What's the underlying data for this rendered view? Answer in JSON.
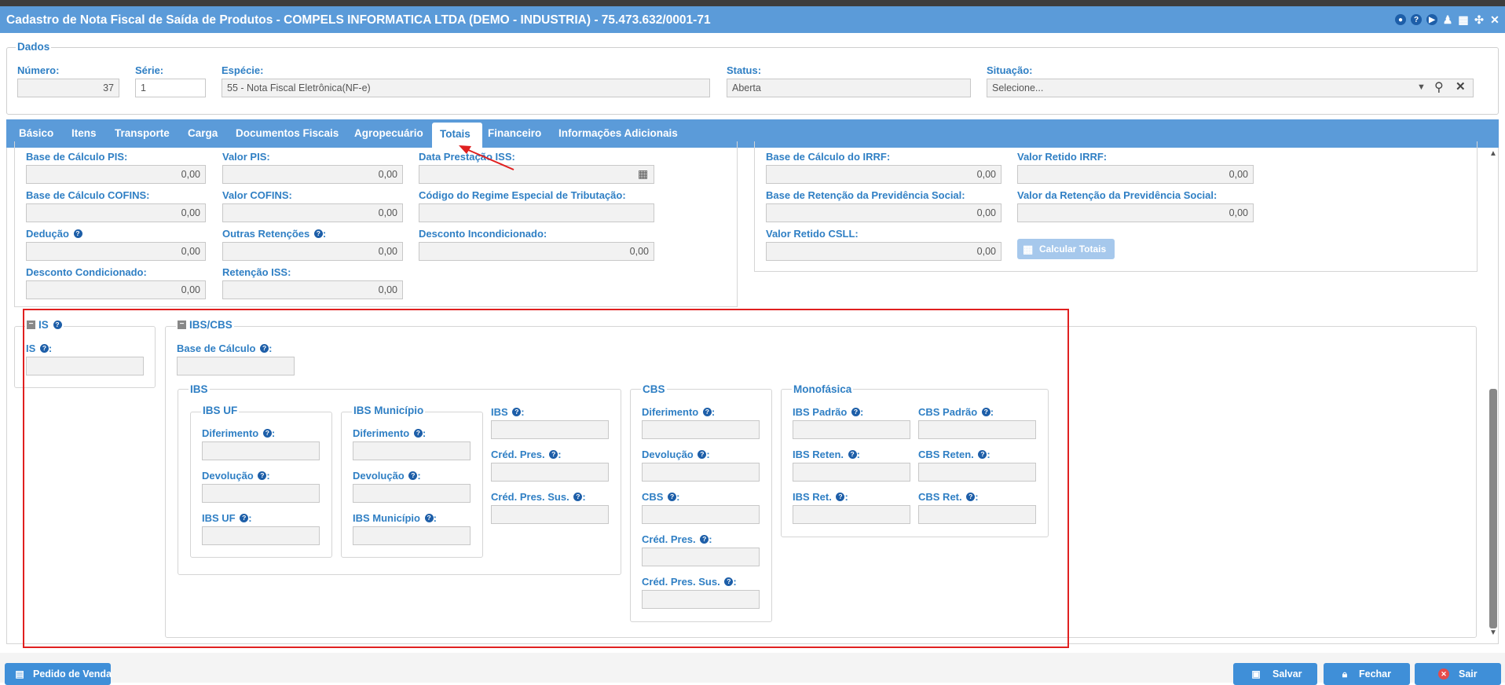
{
  "window": {
    "title": "Cadastro de Nota Fiscal de Saída de Produtos - COMPELS INFORMATICA LTDA (DEMO - INDUSTRIA) - 75.473.632/0001-71",
    "icons": [
      "settings-icon",
      "help-icon",
      "play-icon",
      "user-icon",
      "calendar-icon",
      "fullscreen-icon",
      "close-icon"
    ]
  },
  "dados": {
    "legend": "Dados",
    "numero_label": "Número:",
    "numero_value": "37",
    "serie_label": "Série:",
    "serie_value": "1",
    "especie_label": "Espécie:",
    "especie_value": "55 - Nota Fiscal Eletrônica(NF-e)",
    "status_label": "Status:",
    "status_value": "Aberta",
    "situacao_label": "Situação:",
    "situacao_placeholder": "Selecione..."
  },
  "tabs": [
    "Básico",
    "Itens",
    "Transporte",
    "Carga",
    "Documentos Fiscais",
    "Agropecuário",
    "Totais",
    "Financeiro",
    "Informações Adicionais"
  ],
  "active_tab": "Totais",
  "left_panel": {
    "base_pis_label": "Base de Cálculo PIS:",
    "base_pis_value": "0,00",
    "valor_pis_label": "Valor PIS:",
    "valor_pis_value": "0,00",
    "data_iss_label": "Data Prestação ISS:",
    "base_cofins_label": "Base de Cálculo COFINS:",
    "base_cofins_value": "0,00",
    "valor_cofins_label": "Valor COFINS:",
    "valor_cofins_value": "0,00",
    "regime_label": "Código do Regime Especial de Tributação:",
    "deducao_label": "Dedução",
    "deducao_value": "0,00",
    "outras_label": "Outras Retenções",
    "outras_value": "0,00",
    "desc_incond_label": "Desconto Incondicionado:",
    "desc_incond_value": "0,00",
    "desc_cond_label": "Desconto Condicionado:",
    "desc_cond_value": "0,00",
    "ret_iss_label": "Retenção ISS:",
    "ret_iss_value": "0,00"
  },
  "right_panel": {
    "base_irrf_label": "Base de Cálculo do IRRF:",
    "base_irrf_value": "0,00",
    "valor_irrf_label": "Valor Retido IRRF:",
    "valor_irrf_value": "0,00",
    "base_prev_label": "Base de Retenção da Previdência Social:",
    "base_prev_value": "0,00",
    "valor_prev_label": "Valor da Retenção da Previdência Social:",
    "valor_prev_value": "0,00",
    "csll_label": "Valor Retido CSLL:",
    "csll_value": "0,00",
    "calc_button": "Calcular Totais"
  },
  "is_section": {
    "legend": "IS",
    "is_label": "IS"
  },
  "ibscbs": {
    "legend": "IBS/CBS",
    "base_label": "Base de Cálculo",
    "ibs_legend": "IBS",
    "ibs_uf_legend": "IBS UF",
    "ibs_mun_legend": "IBS Município",
    "diferimento": "Diferimento",
    "devolucao": "Devolução",
    "ibs_uf_label": "IBS UF",
    "ibs_mun_label": "IBS Município",
    "ibs_label": "IBS",
    "cred_pres": "Créd. Pres.",
    "cred_pres_sus": "Créd. Pres. Sus.",
    "cbs_legend": "CBS",
    "cbs_label": "CBS",
    "mono_legend": "Monofásica",
    "ibs_padrao": "IBS Padrão",
    "cbs_padrao": "CBS Padrão",
    "ibs_reten": "IBS Reten.",
    "cbs_reten": "CBS Reten.",
    "ibs_ret": "IBS Ret.",
    "cbs_ret": "CBS Ret."
  },
  "footer": {
    "pedido": "Pedido de Venda",
    "salvar": "Salvar",
    "fechar": "Fechar",
    "sair": "Sair"
  }
}
